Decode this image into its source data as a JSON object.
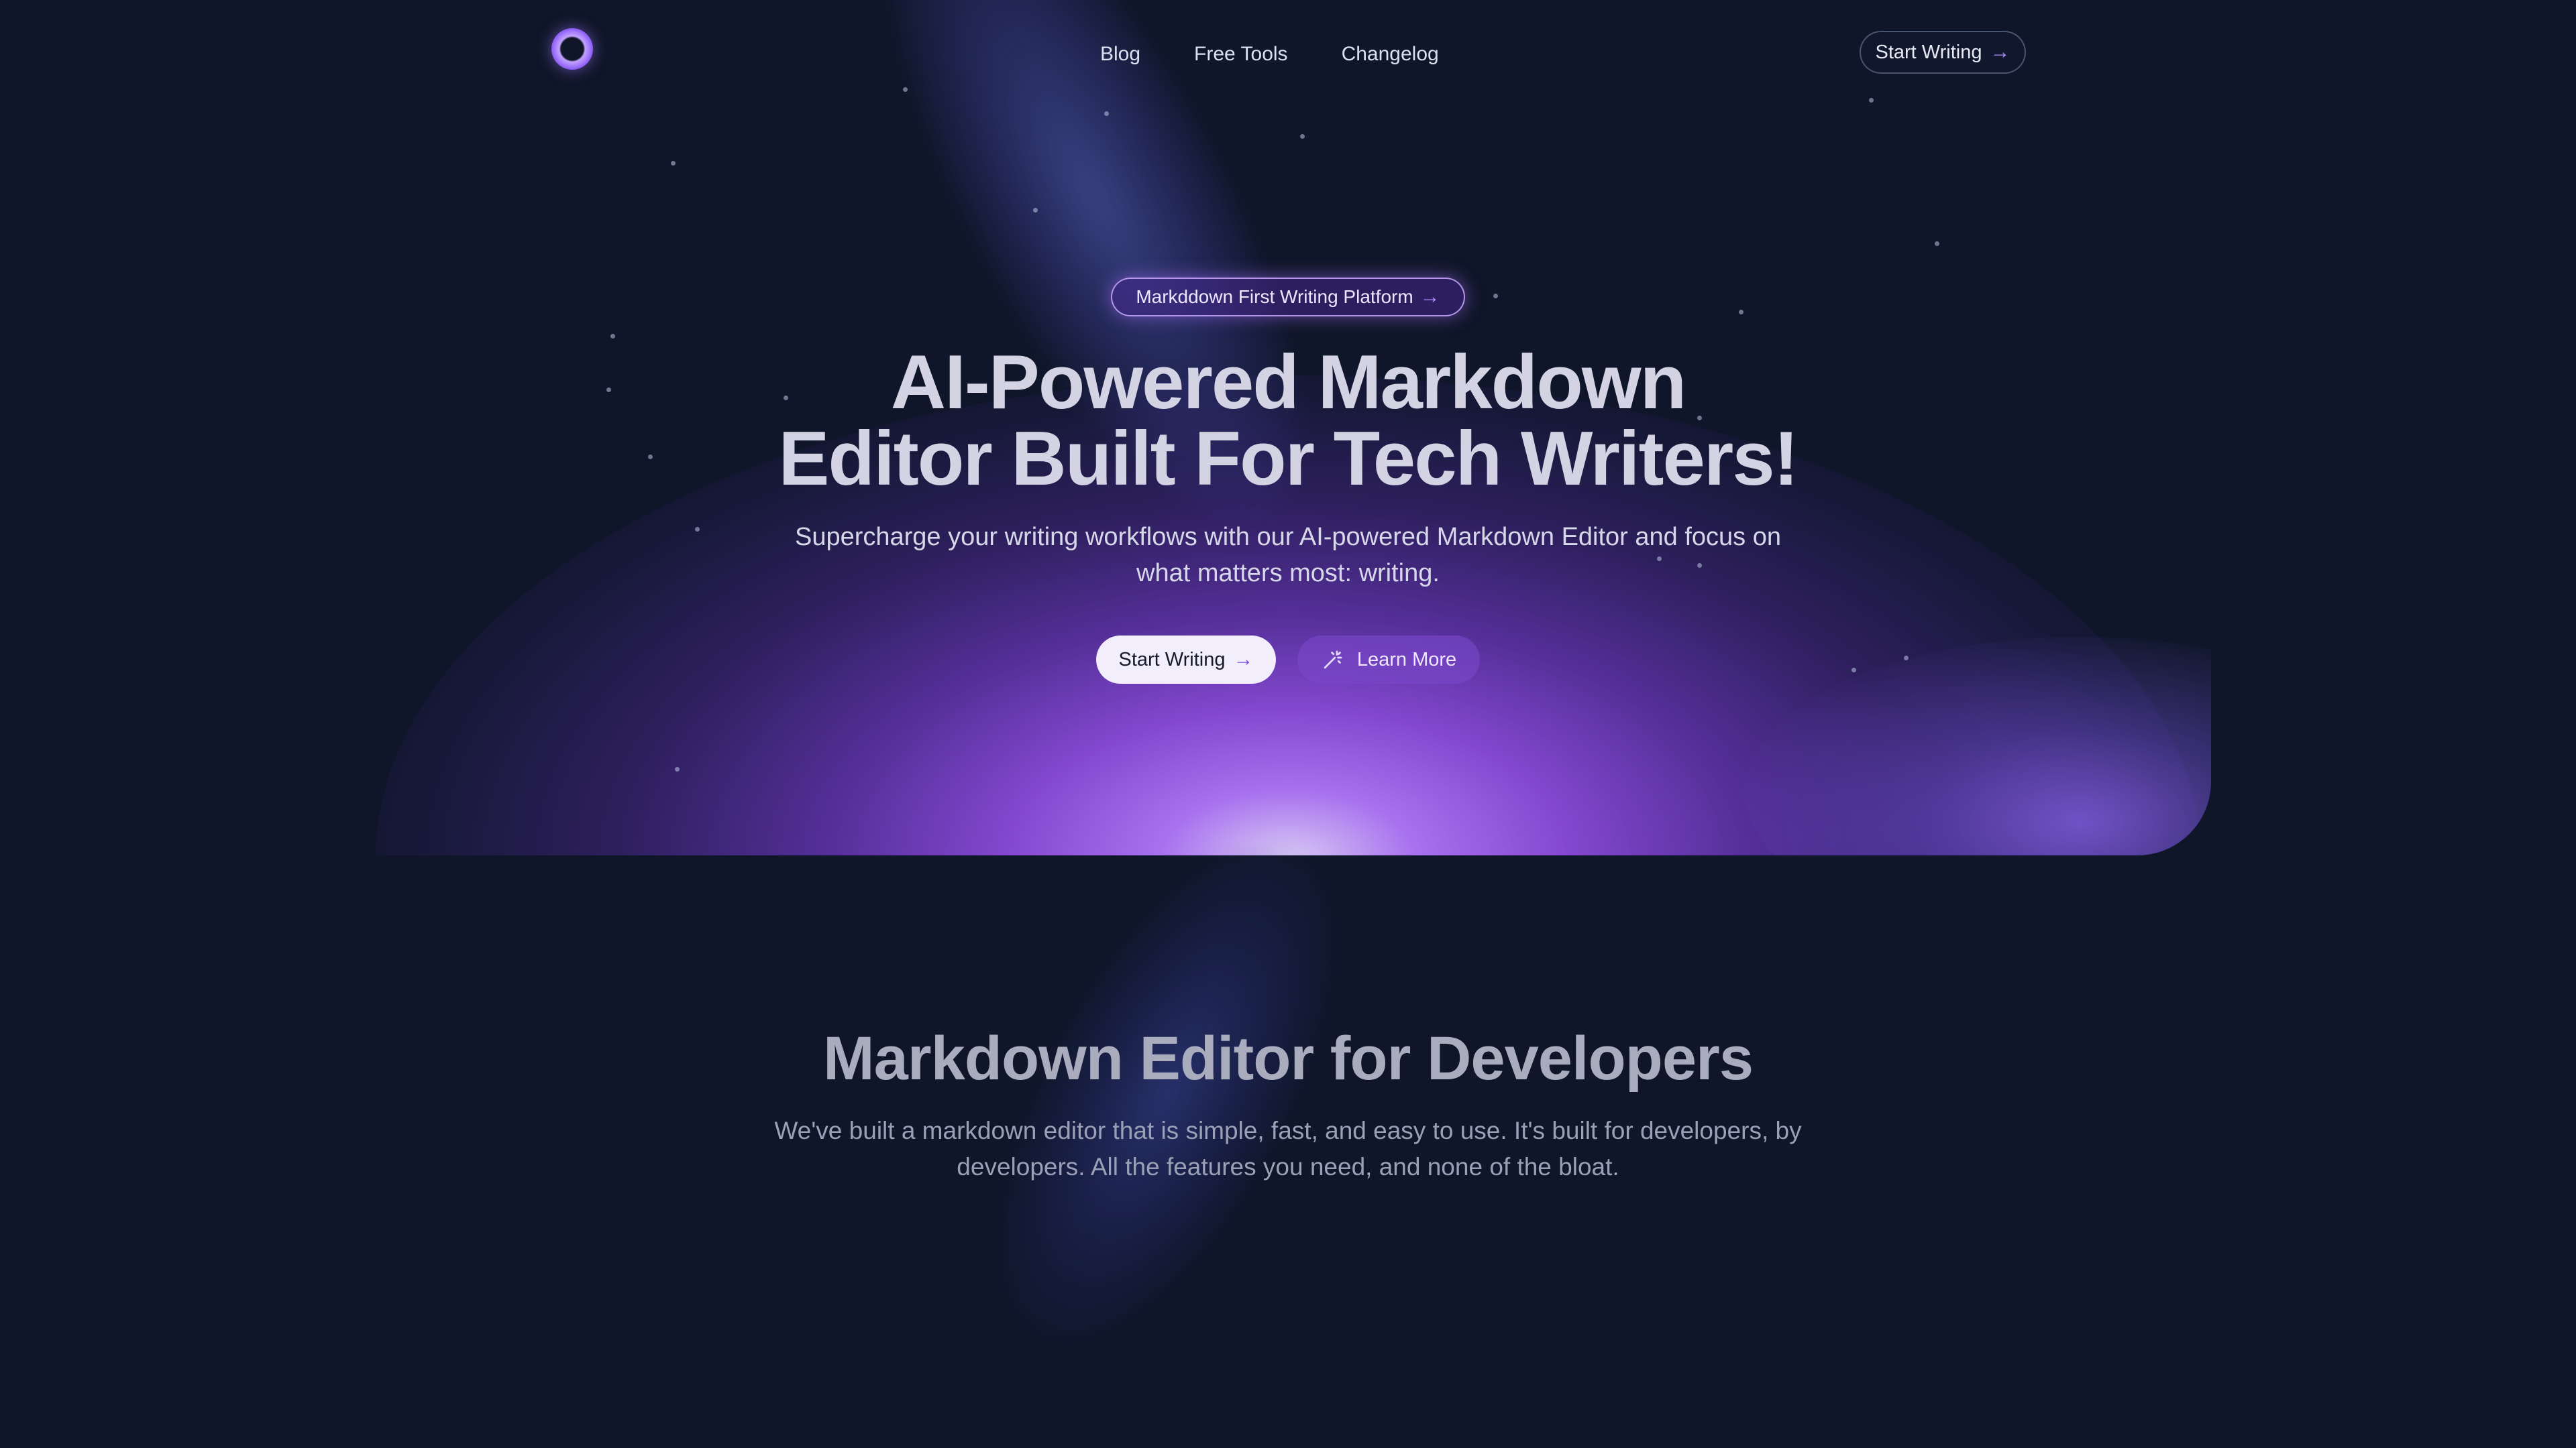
{
  "nav": {
    "links": [
      "Blog",
      "Free Tools",
      "Changelog"
    ],
    "cta_label": "Start Writing"
  },
  "hero": {
    "badge_label": "Markddown First Writing Platform",
    "title_line1": "AI-Powered Markdown",
    "title_line2": "Editor Built For Tech Writers!",
    "subtitle": "Supercharge your writing workflows with our AI-powered Markdown Editor and focus on what matters most: writing.",
    "primary_button": "Start Writing",
    "secondary_button": "Learn More"
  },
  "features": {
    "title": "Markdown Editor for Developers",
    "subtitle": "We've built a markdown editor that is simple, fast, and easy to use. It's built for developers, by developers. All the features you need, and none of the bloat."
  },
  "colors": {
    "background": "#0f1629",
    "accent": "#8b5cf6",
    "accent_light": "#b48cff"
  },
  "icons": {
    "arrow": "arrow-right-icon",
    "wand": "magic-wand-icon",
    "logo": "ring-logo"
  }
}
